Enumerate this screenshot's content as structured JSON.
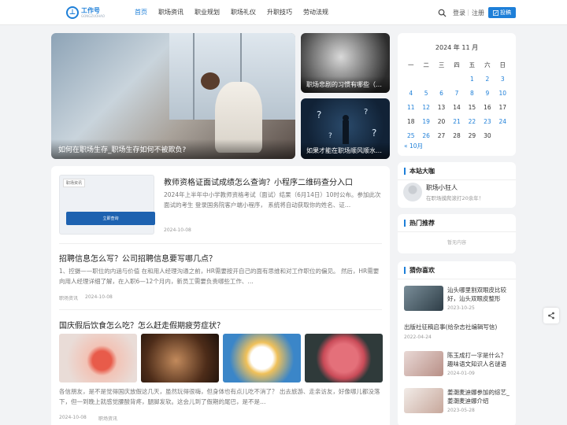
{
  "header": {
    "logo_title": "工作号",
    "logo_sub": "GONGZUOHAO",
    "nav": [
      "首页",
      "职场资讯",
      "职业规划",
      "职场礼仪",
      "升职技巧",
      "劳动法规"
    ],
    "login": "登录",
    "sep": "|",
    "register": "注册",
    "post": "投稿"
  },
  "slider": {
    "main_caption": "如何在职场生存_职场生存如何不被欺负?",
    "small": [
      {
        "caption": "职场悲剧的习惯有哪些（…"
      },
      {
        "caption": "如果才能在职场顺风顺水…"
      }
    ]
  },
  "articles": [
    {
      "title": "教师资格证面试成绩怎么查询？小程序二维码查分入口",
      "excerpt": "2024年上半年中小学教师资格考试（面试）结果（6月14日）10时公布。参加此次面试的考生 登录国务院客户端小程序， 系统将自动获取你的姓名、证…",
      "date": "2024-10-08",
      "thumb_tag": "职场资讯",
      "thumb_button": "立即查询"
    },
    {
      "title": "招聘信息怎么写？公司招聘信息要写哪几点？",
      "excerpt": "1、控摄——职位的内涵与价值 在和用人经理沟通之前，HR需要按开自己的面有思维和对工作职位的偏见。 然后，HR需要向用人经理详细了解，在入职6—12个月内，新员工需要负责哪些工作、…",
      "category": "职场资讯",
      "date": "2024-10-08"
    },
    {
      "title": "国庆假后饮食怎么吃？怎么赶走假期疲劳症状？",
      "excerpt": "各信朋友，是不是觉得国庆放假这几天，虽然玩得很嗨，但身体也有点儿吃不消了？ 出去旅游、走亲访友，好像哪儿都没落下，但一到晚上就感觉腰酸背疼，腿脚发软。这会儿到了假期的尾巴，是不是…",
      "date": "2024-10-08",
      "category": "职场资讯"
    }
  ],
  "calendar": {
    "title": "2024 年 11 月",
    "weekdays": [
      "一",
      "二",
      "三",
      "四",
      "五",
      "六",
      "日"
    ],
    "days": [
      "",
      "",
      "",
      "",
      "1",
      "2",
      "3",
      "4",
      "5",
      "6",
      "7",
      "8",
      "9",
      "10",
      "11",
      "12",
      "13",
      "14",
      "15",
      "16",
      "17",
      "18",
      "19",
      "20",
      "21",
      "22",
      "23",
      "24",
      "25",
      "26",
      "27",
      "28",
      "29",
      "30",
      ""
    ],
    "linked_days": [
      "1",
      "2",
      "3",
      "4",
      "5",
      "6",
      "7",
      "8",
      "9",
      "10",
      "11",
      "12",
      "19",
      "21",
      "22",
      "23",
      "24",
      "25",
      "26"
    ],
    "prev": "« 10月"
  },
  "sidebar": {
    "admin_title": "本站大咖",
    "admin_name": "职场小狂人",
    "admin_desc": "在职场摸爬滚打20余年！",
    "hot_title": "热门推荐",
    "hot_empty": "暂无内容",
    "guess_title": "猜你喜欢",
    "guess": [
      {
        "title": "汕头哪里割双眼皮比较好，汕头双眼皮整形医…",
        "date": "2023-10-25"
      },
      {
        "title": "出版社征稿启事(给杂志社编辑写信)",
        "date": "2022-04-24"
      },
      {
        "title": "陈玉成打一字是什么？趣味语文知识人名谜语",
        "date": "2024-01-09"
      },
      {
        "title": "姜潮麦迪娜参加的综艺_姜潮麦迪娜介绍",
        "date": "2023-05-28"
      }
    ]
  },
  "colors": {
    "accent": "#1e7fd8"
  }
}
